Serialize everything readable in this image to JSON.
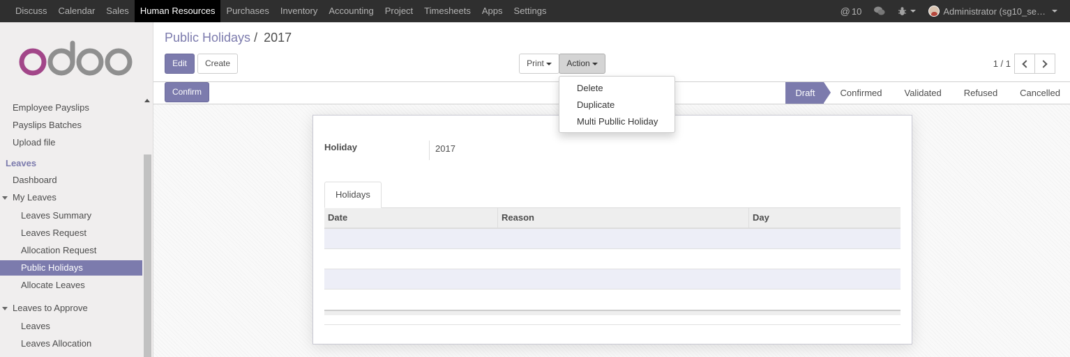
{
  "topbar": {
    "menu": [
      "Discuss",
      "Calendar",
      "Sales",
      "Human Resources",
      "Purchases",
      "Inventory",
      "Accounting",
      "Project",
      "Timesheets",
      "Apps",
      "Settings"
    ],
    "active_menu": "Human Resources",
    "messages_count": "10",
    "user_label": "Administrator (sg10_se…"
  },
  "sidebar": {
    "items": [
      {
        "label": "Employee Payslips"
      },
      {
        "label": "Payslips Batches"
      },
      {
        "label": "Upload file"
      },
      {
        "label": "Leaves"
      },
      {
        "label": "Dashboard"
      },
      {
        "label": "My Leaves"
      },
      {
        "label": "Leaves Summary"
      },
      {
        "label": "Leaves Request"
      },
      {
        "label": "Allocation Request"
      },
      {
        "label": "Public Holidays"
      },
      {
        "label": "Allocate Leaves"
      },
      {
        "label": "Leaves to Approve"
      },
      {
        "label": "Leaves"
      },
      {
        "label": "Leaves Allocation"
      }
    ]
  },
  "breadcrumb": {
    "parent": "Public Holidays",
    "separator": "/",
    "current": "2017"
  },
  "toolbar": {
    "edit": "Edit",
    "create": "Create",
    "print": "Print",
    "action": "Action",
    "pager": "1 / 1"
  },
  "statusbar": {
    "confirm": "Confirm",
    "stages": [
      "Draft",
      "Confirmed",
      "Validated",
      "Refused",
      "Cancelled"
    ],
    "active_stage": "Draft"
  },
  "action_menu": {
    "items": [
      "Delete",
      "Duplicate",
      "Multi Publlic Holiday"
    ]
  },
  "form": {
    "holiday_label": "Holiday",
    "holiday_value": "2017",
    "tab": "Holidays",
    "columns": [
      "Date",
      "Reason",
      "Day"
    ]
  },
  "colors": {
    "brand": "#7c7bad",
    "topbar": "#2f2f2f"
  }
}
